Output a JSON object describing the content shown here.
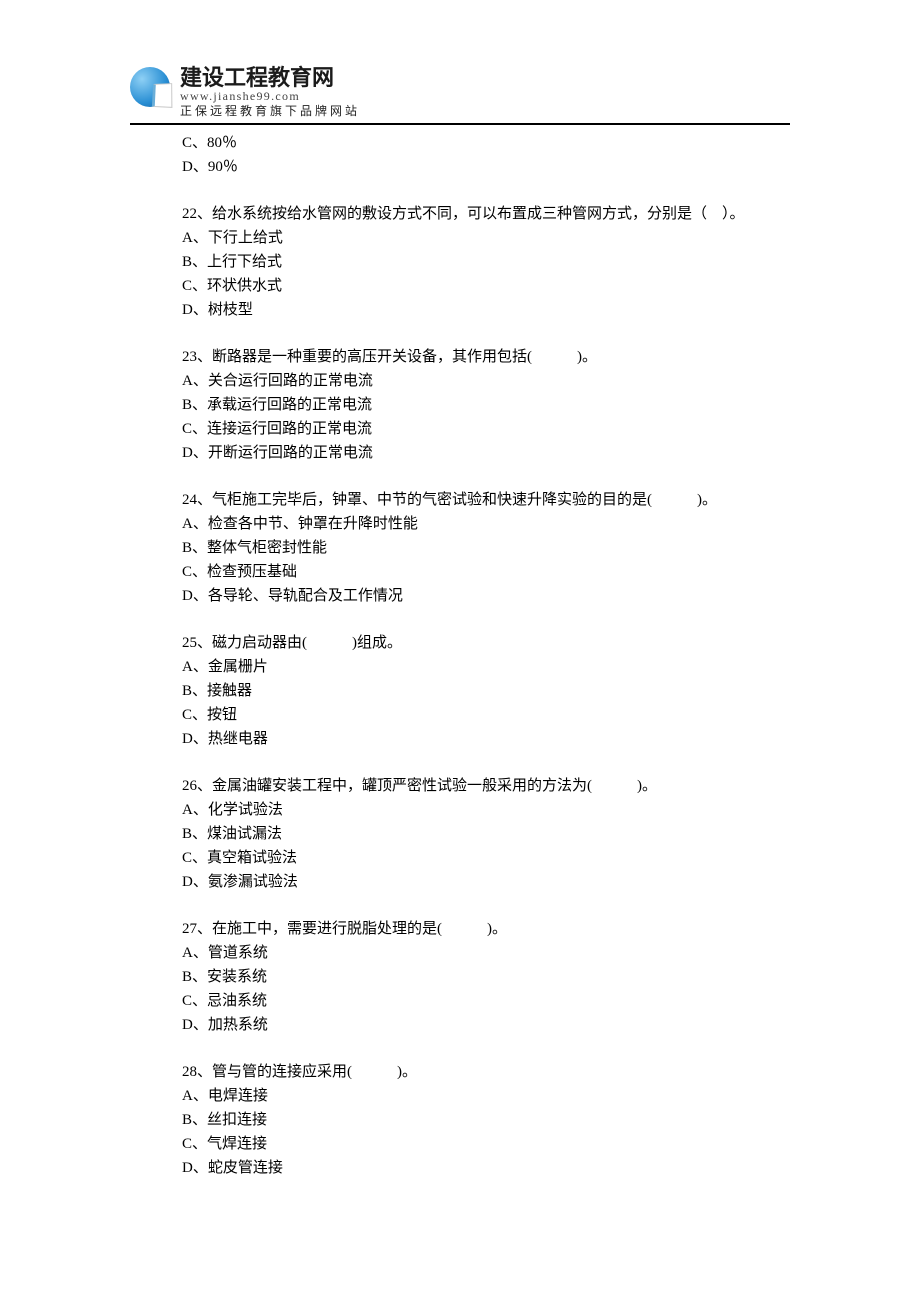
{
  "header": {
    "title": "建设工程教育网",
    "url": "www.jianshe99.com",
    "tagline": "正保远程教育旗下品牌网站"
  },
  "leading_options": [
    "C、80％",
    "D、90％"
  ],
  "questions": [
    {
      "stem": "22、给水系统按给水管网的敷设方式不同，可以布置成三种管网方式，分别是（　）。",
      "options": [
        "A、下行上给式",
        "B、上行下给式",
        "C、环状供水式",
        "D、树枝型"
      ]
    },
    {
      "stem": "23、断路器是一种重要的高压开关设备，其作用包括(　　　)。",
      "options": [
        "A、关合运行回路的正常电流",
        "B、承载运行回路的正常电流",
        "C、连接运行回路的正常电流",
        "D、开断运行回路的正常电流"
      ]
    },
    {
      "stem": "24、气柜施工完毕后，钟罩、中节的气密试验和快速升降实验的目的是(　　　)。",
      "options": [
        "A、检查各中节、钟罩在升降时性能",
        "B、整体气柜密封性能",
        "C、检查预压基础",
        "D、各导轮、导轨配合及工作情况"
      ]
    },
    {
      "stem": "25、磁力启动器由(　　　)组成。",
      "options": [
        "A、金属栅片",
        "B、接触器",
        "C、按钮",
        "D、热继电器"
      ]
    },
    {
      "stem": "26、金属油罐安装工程中，罐顶严密性试验一般采用的方法为(　　　)。",
      "options": [
        "A、化学试验法",
        "B、煤油试漏法",
        "C、真空箱试验法",
        "D、氨渗漏试验法"
      ]
    },
    {
      "stem": "27、在施工中，需要进行脱脂处理的是(　　　)。",
      "options": [
        "A、管道系统",
        "B、安装系统",
        "C、忌油系统",
        "D、加热系统"
      ]
    },
    {
      "stem": "28、管与管的连接应采用(　　　)。",
      "options": [
        "A、电焊连接",
        "B、丝扣连接",
        "C、气焊连接",
        "D、蛇皮管连接"
      ]
    }
  ]
}
